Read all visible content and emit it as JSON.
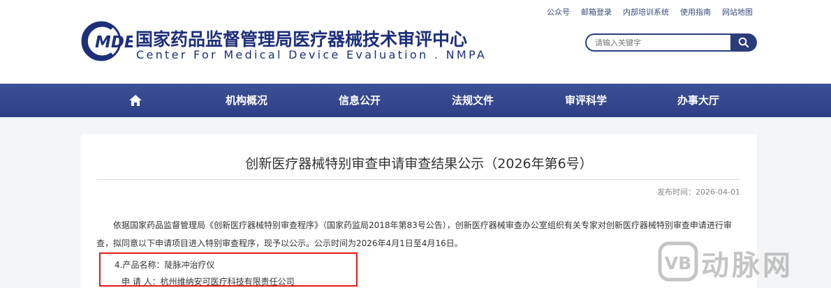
{
  "header": {
    "top_links": [
      "公众号",
      "邮箱登录",
      "内部培训系统",
      "使用指南",
      "网站地图"
    ],
    "logo_text": "MDE",
    "title_cn": "国家药品监督管理局医疗器械技术审评中心",
    "title_en": "Center For Medical Device Evaluation . NMPA",
    "search": {
      "placeholder": "请输入关键字"
    }
  },
  "nav": {
    "home_icon": "home-icon",
    "items": [
      "机构概况",
      "信息公开",
      "法规文件",
      "审评科学",
      "办事大厅"
    ]
  },
  "article": {
    "title": "创新医疗器械特别审查申请审查结果公示（2026年第6号）",
    "date": "发布时间：2026-04-01",
    "body": "依据国家药品监督管理局《创新医疗器械特别审查程序》（国家药监局2018年第83号公告），创新医疗器械审查办公室组织有关专家对创新医疗器械特别审查申请进行审查，拟同意以下申请项目进入特别审查程序，现予以公示。公示时间为2026年4月1日至4月16日。",
    "product_line": "4.产品名称：陡脉冲治疗仪",
    "applicant_line": "申 请 人：杭州维纳安可医疗科技有限责任公司"
  },
  "watermark": {
    "text": "动脉网",
    "logo": "VB"
  },
  "colors": {
    "brand_blue": "#2b3c7c",
    "nav_bg": "#34478c",
    "highlight_red": "#e11b1b"
  }
}
